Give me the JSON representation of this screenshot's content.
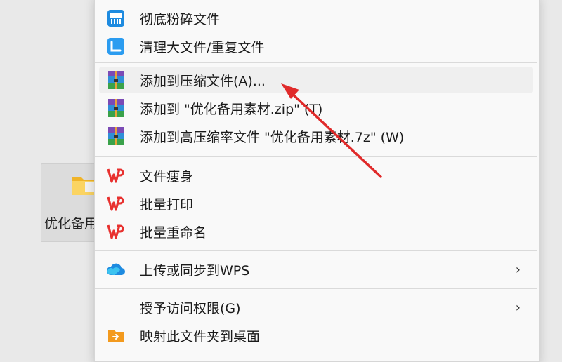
{
  "desktop": {
    "folder_label": "优化备用"
  },
  "menu": {
    "items": [
      {
        "label": "彻底粉碎文件",
        "icon": "shredder-icon"
      },
      {
        "label": "清理大文件/重复文件",
        "icon": "cleanup-icon"
      },
      {
        "label": "添加到压缩文件(A)...",
        "icon": "winrar-icon"
      },
      {
        "label": "添加到 \"优化备用素材.zip\" (T)",
        "icon": "winrar-icon"
      },
      {
        "label": "添加到高压缩率文件 \"优化备用素材.7z\" (W)",
        "icon": "winrar-icon"
      },
      {
        "label": "文件瘦身",
        "icon": "wps-icon"
      },
      {
        "label": "批量打印",
        "icon": "wps-icon"
      },
      {
        "label": "批量重命名",
        "icon": "wps-icon"
      },
      {
        "label": "上传或同步到WPS",
        "icon": "cloud-icon"
      },
      {
        "label": "授予访问权限(G)",
        "icon": ""
      },
      {
        "label": "映射此文件夹到桌面",
        "icon": "folder-map-icon"
      }
    ],
    "submenu_glyph": "›"
  },
  "colors": {
    "wps_red": "#e8312f",
    "accent_blue": "#1e8be0",
    "arrow_red": "#e02a2a"
  }
}
